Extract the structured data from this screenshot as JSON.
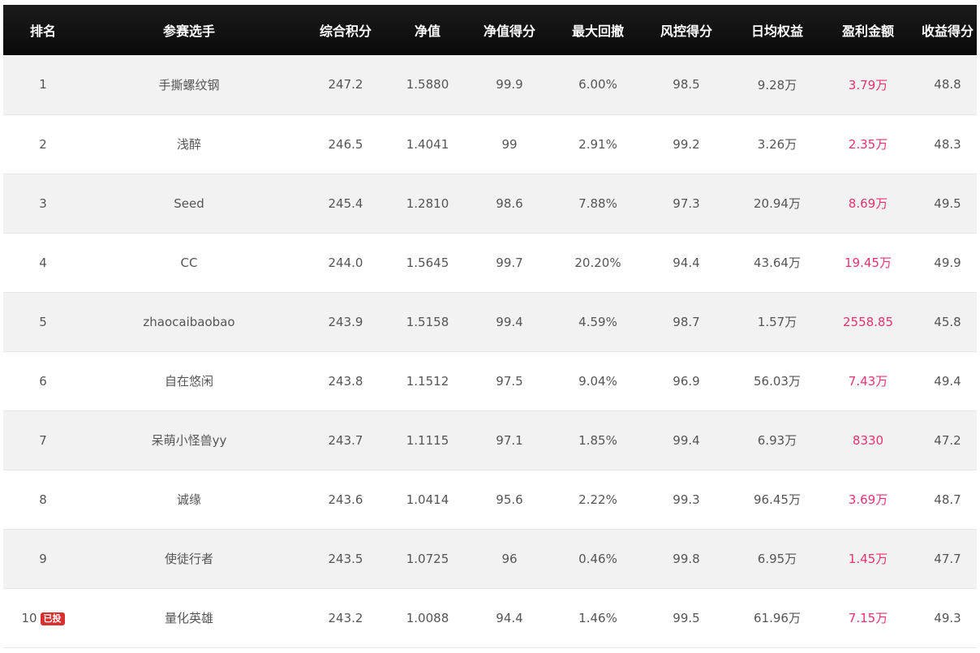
{
  "headers": [
    "排名",
    "参赛选手",
    "综合积分",
    "净值",
    "净值得分",
    "最大回撤",
    "风控得分",
    "日均权益",
    "盈利金额",
    "收益得分"
  ],
  "rows": [
    {
      "rank": "1",
      "badge": "",
      "name": "手撕螺纹钢",
      "score": "247.2",
      "nav": "1.5880",
      "nav_score": "99.9",
      "drawdown": "6.00%",
      "risk_score": "98.5",
      "avg_equity": "9.28万",
      "profit": "3.79万",
      "return_score": "48.8"
    },
    {
      "rank": "2",
      "badge": "",
      "name": "浅醉",
      "score": "246.5",
      "nav": "1.4041",
      "nav_score": "99",
      "drawdown": "2.91%",
      "risk_score": "99.2",
      "avg_equity": "3.26万",
      "profit": "2.35万",
      "return_score": "48.3"
    },
    {
      "rank": "3",
      "badge": "",
      "name": "Seed",
      "score": "245.4",
      "nav": "1.2810",
      "nav_score": "98.6",
      "drawdown": "7.88%",
      "risk_score": "97.3",
      "avg_equity": "20.94万",
      "profit": "8.69万",
      "return_score": "49.5"
    },
    {
      "rank": "4",
      "badge": "",
      "name": "CC",
      "score": "244.0",
      "nav": "1.5645",
      "nav_score": "99.7",
      "drawdown": "20.20%",
      "risk_score": "94.4",
      "avg_equity": "43.64万",
      "profit": "19.45万",
      "return_score": "49.9"
    },
    {
      "rank": "5",
      "badge": "",
      "name": "zhaocaibaobao",
      "score": "243.9",
      "nav": "1.5158",
      "nav_score": "99.4",
      "drawdown": "4.59%",
      "risk_score": "98.7",
      "avg_equity": "1.57万",
      "profit": "2558.85",
      "return_score": "45.8"
    },
    {
      "rank": "6",
      "badge": "",
      "name": "自在悠闲",
      "score": "243.8",
      "nav": "1.1512",
      "nav_score": "97.5",
      "drawdown": "9.04%",
      "risk_score": "96.9",
      "avg_equity": "56.03万",
      "profit": "7.43万",
      "return_score": "49.4"
    },
    {
      "rank": "7",
      "badge": "",
      "name": "呆萌小怪兽yy",
      "score": "243.7",
      "nav": "1.1115",
      "nav_score": "97.1",
      "drawdown": "1.85%",
      "risk_score": "99.4",
      "avg_equity": "6.93万",
      "profit": "8330",
      "return_score": "47.2"
    },
    {
      "rank": "8",
      "badge": "",
      "name": "诚缘",
      "score": "243.6",
      "nav": "1.0414",
      "nav_score": "95.6",
      "drawdown": "2.22%",
      "risk_score": "99.3",
      "avg_equity": "96.45万",
      "profit": "3.69万",
      "return_score": "48.7"
    },
    {
      "rank": "9",
      "badge": "",
      "name": "使徒行者",
      "score": "243.5",
      "nav": "1.0725",
      "nav_score": "96",
      "drawdown": "0.46%",
      "risk_score": "99.8",
      "avg_equity": "6.95万",
      "profit": "1.45万",
      "return_score": "47.7"
    },
    {
      "rank": "10",
      "badge": "已投",
      "name": "量化英雄",
      "score": "243.2",
      "nav": "1.0088",
      "nav_score": "94.4",
      "drawdown": "1.46%",
      "risk_score": "99.5",
      "avg_equity": "61.96万",
      "profit": "7.15万",
      "return_score": "49.3"
    }
  ],
  "colors": {
    "header_bg": "#111111",
    "header_text": "#ffffff",
    "row_stripe": "#f2f2f2",
    "profit_text": "#e8336e",
    "badge_bg": "#d9302f"
  }
}
